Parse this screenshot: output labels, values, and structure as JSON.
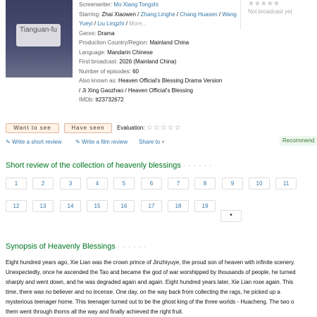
{
  "poster": {
    "tag": "Tianguan-fu"
  },
  "info": {
    "screenwriter_label": "Screenwriter:",
    "screenwriter": "Mo Xiang Tongshi",
    "starring_label": "Starring:",
    "star1": "Zhai Xiaowen",
    "star2": "Zhang Linghe",
    "star3": "Chang Huasen",
    "star4": "Wang Yueyi",
    "star5": "Liu Lingzhi",
    "more": "More...",
    "sep": " / ",
    "genre_label": "Genre:",
    "genre": "Drama",
    "country_label": "Production Country/Region:",
    "country_region": "Mainland",
    "country": "China",
    "language_label": "Language:",
    "language": "Mandarin Chinese",
    "broadcast_label": "First broadcast:",
    "broadcast": "2026 (Mainland China)",
    "episodes_label": "Number of episodes:",
    "episodes": "60",
    "aka_label": "Also known as:",
    "aka_line1": "Heaven Official's Blessing Drama Version",
    "aka_line2": "/ Ji Xing Gaozhao / Heaven Official's Blessing",
    "imdb_label": "IMDb:",
    "imdb": "tt23732672"
  },
  "rating": {
    "stars": "★★★★★",
    "status": "Not broadcast yet"
  },
  "buttons": {
    "want": "Want to see",
    "have": "Have seen"
  },
  "evaluation": {
    "label": "Evaluation:",
    "stars": "☆☆☆☆☆"
  },
  "actions": {
    "short_review": "Write a short review",
    "film_review": "Write a film review",
    "share": "Share to"
  },
  "recommend": "Recommend",
  "short_review_section": {
    "title": "Short review of the collection of heavenly blessings",
    "dots": "· · · · · ·"
  },
  "pages_row1": [
    "1",
    "2",
    "3",
    "4",
    "5",
    "6",
    "7",
    "8",
    "9",
    "10",
    "11"
  ],
  "pages_row2": [
    "12",
    "13",
    "14",
    "15",
    "16",
    "17",
    "18",
    "19"
  ],
  "synopsis_section": {
    "title": "Synopsis of Heavenly Blessings",
    "dots": "· · · · · ·"
  },
  "synopsis_lines": [
    "Eight hundred years ago, Xie Lian was the crown prince of Jinzhiyuye, the proud son of heaven with infinite scenery.",
    "Unexpectedly, once he ascended the Tao and became the god of war worshipped by thousands of people, he turned",
    "sharply and went down, and he was degraded again and again. Eight hundred years later, Xie Lian rose again. This",
    "time, there was no believer and no incense. One day, on the way back from collecting the rags, he picked up a",
    "mysterious teenager home. This teenager turned out to be the ghost king of the three worlds - Huacheng. The two o",
    "them went through thorns all the way and finally achieved the right fruit."
  ]
}
